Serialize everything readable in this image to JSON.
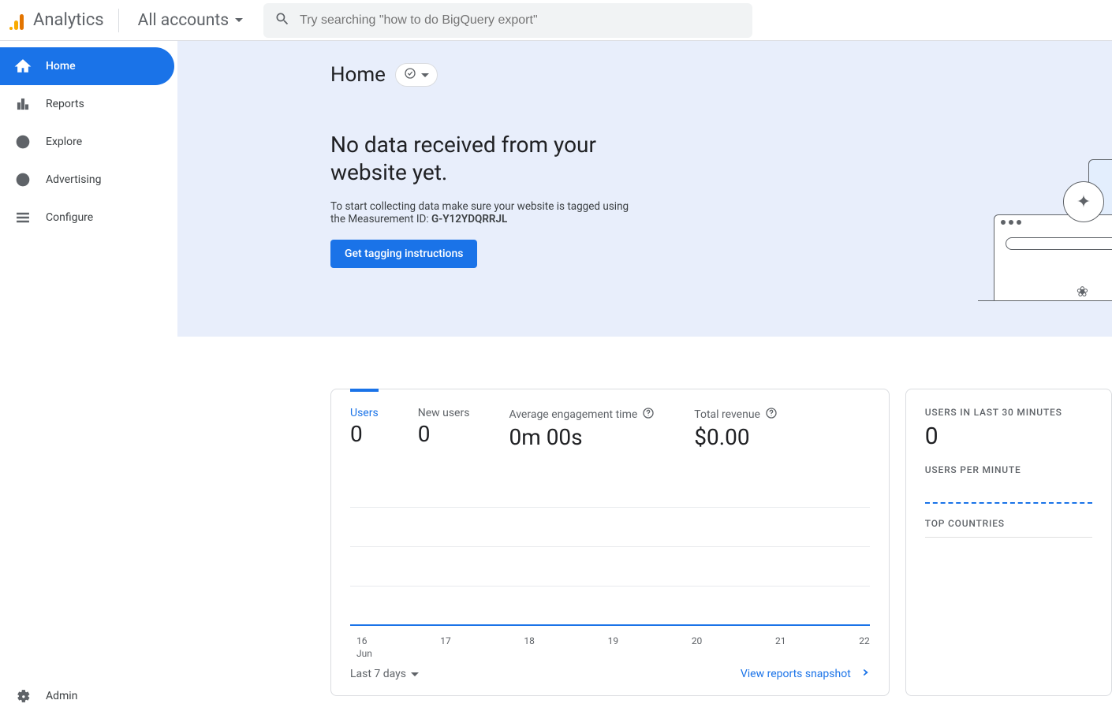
{
  "app": {
    "name": "Analytics",
    "account": "All accounts"
  },
  "search": {
    "placeholder": "Try searching \"how to do BigQuery export\""
  },
  "sidebar": {
    "items": [
      {
        "label": "Home"
      },
      {
        "label": "Reports"
      },
      {
        "label": "Explore"
      },
      {
        "label": "Advertising"
      },
      {
        "label": "Configure"
      }
    ],
    "footer": {
      "label": "Admin"
    }
  },
  "hero": {
    "page_title": "Home",
    "heading": "No data received from your website yet.",
    "sub_prefix": "To start collecting data make sure your website is tagged using the Measurement ID: ",
    "measurement_id": "G-Y12YDQRRJL",
    "cta": "Get tagging instructions"
  },
  "metrics": [
    {
      "label": "Users",
      "value": "0",
      "active": true,
      "help": false
    },
    {
      "label": "New users",
      "value": "0",
      "active": false,
      "help": false
    },
    {
      "label": "Average engagement time",
      "value": "0m 00s",
      "active": false,
      "help": true
    },
    {
      "label": "Total revenue",
      "value": "$0.00",
      "active": false,
      "help": true
    }
  ],
  "chart_data": {
    "type": "line",
    "categories": [
      "16",
      "17",
      "18",
      "19",
      "20",
      "21",
      "22"
    ],
    "month": "Jun",
    "values": [
      0,
      0,
      0,
      0,
      0,
      0,
      0
    ],
    "ylim": [
      0,
      1
    ]
  },
  "card_main": {
    "range_label": "Last 7 days",
    "action_label": "View reports snapshot"
  },
  "card_side": {
    "section1_label": "USERS IN LAST 30 MINUTES",
    "section1_value": "0",
    "section2_label": "USERS PER MINUTE",
    "section3_label": "TOP COUNTRIES"
  }
}
